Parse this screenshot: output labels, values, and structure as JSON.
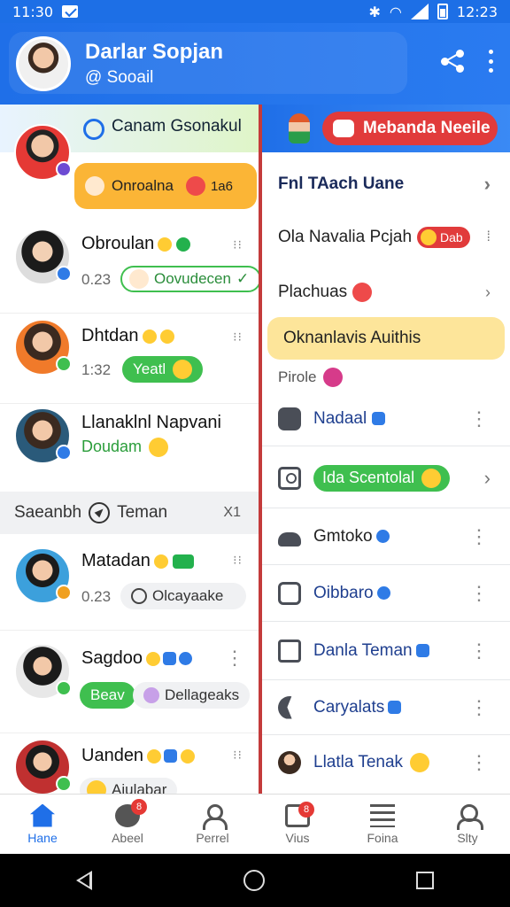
{
  "status": {
    "time_left": "11:30",
    "time_right": "12:23"
  },
  "header": {
    "name": "Darlar Sopjan",
    "handle": "@ Sooail"
  },
  "left_panel": {
    "top_banner": "Canam Gsonakul",
    "chats": [
      {
        "name": "",
        "pill": "Onroalna",
        "pill_badge": "1a6"
      },
      {
        "name": "Obroulan",
        "time": "0.23",
        "pill": "Oovudecen"
      },
      {
        "name": "Dhtdan",
        "time": "1:32",
        "pill": "Yeatl"
      },
      {
        "name": "Llanaklnl Napvani",
        "sub": "Doudam"
      },
      {
        "name": "Matadan",
        "time": "0.23",
        "pill": "Olcayaake"
      },
      {
        "name": "Sagdoo",
        "pill": "Beav",
        "pill2": "Dellageaks"
      },
      {
        "name": "Uanden",
        "pill": "Aiulabar"
      }
    ],
    "section": {
      "left": "Saeanbh",
      "label": "Teman",
      "right": "X1"
    }
  },
  "right_panel": {
    "top_chip": "Mebanda Neeile",
    "items": [
      {
        "label": "Fnl TAach Uane"
      },
      {
        "label": "Ola Navalia Pcjah",
        "badge": "Dab"
      },
      {
        "label": "Plachuas"
      },
      {
        "label": "Oknanlavis Auithis"
      },
      {
        "label": "Pirole"
      },
      {
        "label": "Nadaal"
      },
      {
        "label": "Ida Scentolal"
      },
      {
        "label": "Gmtoko"
      },
      {
        "label": "Oibbaro"
      },
      {
        "label": "Danla Teman"
      },
      {
        "label": "Caryalats"
      },
      {
        "label": "Llatla Tenak"
      }
    ]
  },
  "bottom_nav": [
    {
      "label": "Hane"
    },
    {
      "label": "Abeel",
      "badge": "8"
    },
    {
      "label": "Perrel"
    },
    {
      "label": "Vius",
      "badge": "8"
    },
    {
      "label": "Foina"
    },
    {
      "label": "Slty"
    }
  ],
  "colors": {
    "primary": "#1f6fe8",
    "accent_red": "#e13b3b",
    "green": "#3fbf4f",
    "highlight_yellow": "#fde59a"
  }
}
